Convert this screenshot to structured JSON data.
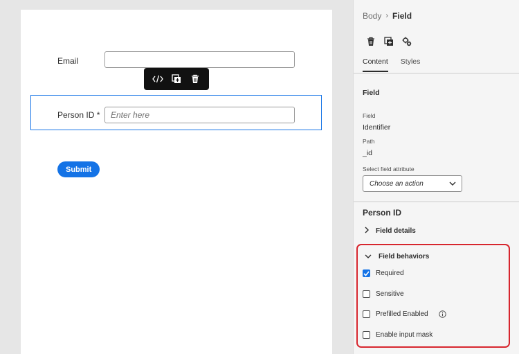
{
  "form": {
    "email_label": "Email",
    "email_value": "",
    "person_label": "Person ID *",
    "person_placeholder": "Enter here",
    "submit_label": "Submit",
    "toolbar_icons": [
      "code-icon",
      "duplicate-icon",
      "trash-icon"
    ]
  },
  "panel": {
    "breadcrumb": {
      "parent": "Body",
      "separator": "›",
      "current": "Field"
    },
    "action_icons": [
      "trash-icon",
      "duplicate-icon",
      "settings-icon"
    ],
    "tabs": [
      {
        "label": "Content",
        "active": true
      },
      {
        "label": "Styles",
        "active": false
      }
    ],
    "section_heading": "Field",
    "field_label": "Field",
    "field_value": "Identifier",
    "path_label": "Path",
    "path_value": "_id",
    "select_label": "Select field attribute",
    "select_value": "Choose an action",
    "component_heading": "Person ID",
    "details_label": "Field details",
    "behaviors_label": "Field behaviors",
    "behaviors": [
      {
        "label": "Required",
        "checked": true
      },
      {
        "label": "Sensitive",
        "checked": false
      },
      {
        "label": "Prefilled Enabled",
        "checked": false
      },
      {
        "label": "Enable input mask",
        "checked": false
      }
    ]
  },
  "colors": {
    "accent": "#1473e6",
    "highlight": "#d7262e",
    "panel_bg": "#f5f5f5",
    "page_bg": "#e6e6e6"
  }
}
